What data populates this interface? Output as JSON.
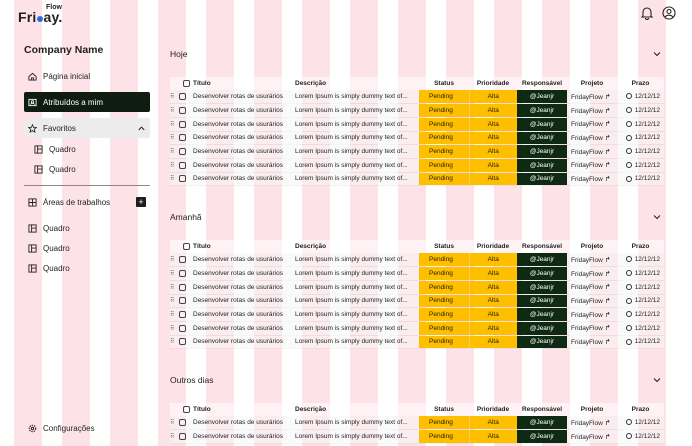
{
  "logo": {
    "flow": "Flow",
    "friday_a": "Fri",
    "friday_b": "ay."
  },
  "sidebar": {
    "company": "Company Name",
    "items": [
      {
        "label": "Página inicial",
        "icon": "home-icon"
      },
      {
        "label": "Atribuídos a mim",
        "icon": "person-card-icon"
      },
      {
        "label": "Favoritos",
        "icon": "star-icon"
      }
    ],
    "favorites": [
      "Quadro",
      "Quadro"
    ],
    "areas_label": "Áreas de trabalhos",
    "areas": [
      "Quadro",
      "Quadro",
      "Quadro"
    ],
    "settings": "Configurações"
  },
  "columns": {
    "titulo": "Título",
    "descricao": "Descrição",
    "status": "Status",
    "prioridade": "Prioridade",
    "responsavel": "Responsável",
    "projeto": "Projeto",
    "prazo": "Prazo"
  },
  "sections": [
    {
      "title": "Hoje",
      "rows": [
        {
          "title": "Desenvolver rotas de usurários",
          "desc": "Lorem Ipsum is simply dummy text of...",
          "status": "Pending",
          "priority": "Alta",
          "owner": "@Jeanjr",
          "project": "FridayFlow",
          "due": "12/12/12"
        },
        {
          "title": "Desenvolver rotas de usurários",
          "desc": "Lorem Ipsum is simply dummy text of...",
          "status": "Pending",
          "priority": "Alta",
          "owner": "@Jeanjr",
          "project": "FridayFlow",
          "due": "12/12/12"
        },
        {
          "title": "Desenvolver rotas de usurários",
          "desc": "Lorem Ipsum is simply dummy text of...",
          "status": "Pending",
          "priority": "Alta",
          "owner": "@Jeanjr",
          "project": "FridayFlow",
          "due": "12/12/12"
        },
        {
          "title": "Desenvolver rotas de usurários",
          "desc": "Lorem Ipsum is simply dummy text of...",
          "status": "Pending",
          "priority": "Alta",
          "owner": "@Jeanjr",
          "project": "FridayFlow",
          "due": "12/12/12"
        },
        {
          "title": "Desenvolver rotas de usurários",
          "desc": "Lorem Ipsum is simply dummy text of...",
          "status": "Pending",
          "priority": "Alta",
          "owner": "@Jeanjr",
          "project": "FridayFlow",
          "due": "12/12/12"
        },
        {
          "title": "Desenvolver rotas de usurários",
          "desc": "Lorem Ipsum is simply dummy text of...",
          "status": "Pending",
          "priority": "Alta",
          "owner": "@Jeanjr",
          "project": "FridayFlow",
          "due": "12/12/12"
        },
        {
          "title": "Desenvolver rotas de usurários",
          "desc": "Lorem Ipsum is simply dummy text of...",
          "status": "Pending",
          "priority": "Alta",
          "owner": "@Jeanjr",
          "project": "FridayFlow",
          "due": "12/12/12"
        }
      ]
    },
    {
      "title": "Amanhã",
      "rows": [
        {
          "title": "Desenvolver rotas de usurários",
          "desc": "Lorem Ipsum is simply dummy text of...",
          "status": "Pending",
          "priority": "Alta",
          "owner": "@Jeanjr",
          "project": "FridayFlow",
          "due": "12/12/12"
        },
        {
          "title": "Desenvolver rotas de usurários",
          "desc": "Lorem Ipsum is simply dummy text of...",
          "status": "Pending",
          "priority": "Alta",
          "owner": "@Jeanjr",
          "project": "FridayFlow",
          "due": "12/12/12"
        },
        {
          "title": "Desenvolver rotas de usurários",
          "desc": "Lorem Ipsum is simply dummy text of...",
          "status": "Pending",
          "priority": "Alta",
          "owner": "@Jeanjr",
          "project": "FridayFlow",
          "due": "12/12/12"
        },
        {
          "title": "Desenvolver rotas de usurários",
          "desc": "Lorem Ipsum is simply dummy text of...",
          "status": "Pending",
          "priority": "Alta",
          "owner": "@Jeanjr",
          "project": "FridayFlow",
          "due": "12/12/12"
        },
        {
          "title": "Desenvolver rotas de usurários",
          "desc": "Lorem Ipsum is simply dummy text of...",
          "status": "Pending",
          "priority": "Alta",
          "owner": "@Jeanjr",
          "project": "FridayFlow",
          "due": "12/12/12"
        },
        {
          "title": "Desenvolver rotas de usurários",
          "desc": "Lorem Ipsum is simply dummy text of...",
          "status": "Pending",
          "priority": "Alta",
          "owner": "@Jeanjr",
          "project": "FridayFlow",
          "due": "12/12/12"
        },
        {
          "title": "Desenvolver rotas de usurários",
          "desc": "Lorem Ipsum is simply dummy text of...",
          "status": "Pending",
          "priority": "Alta",
          "owner": "@Jeanjr",
          "project": "FridayFlow",
          "due": "12/12/12"
        }
      ]
    },
    {
      "title": "Outros dias",
      "rows": [
        {
          "title": "Desenvolver rotas de usurários",
          "desc": "Lorem Ipsum is simply dummy text of...",
          "status": "Pending",
          "priority": "Alta",
          "owner": "@Jeanjr",
          "project": "FridayFlow",
          "due": "12/12/12"
        },
        {
          "title": "Desenvolver rotas de usurários",
          "desc": "Lorem Ipsum is simply dummy text of...",
          "status": "Pending",
          "priority": "Alta",
          "owner": "@Jeanjr",
          "project": "FridayFlow",
          "due": "12/12/12"
        }
      ]
    }
  ],
  "colors": {
    "status": "#fdbf00",
    "responsible": "#0f2a12",
    "active_nav": "#0f1d10",
    "stripe": "#fde3e7"
  }
}
